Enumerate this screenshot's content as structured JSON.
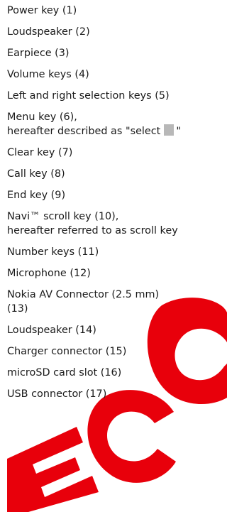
{
  "items": [
    {
      "label": "Power key (1)"
    },
    {
      "label": "Loudspeaker (2)"
    },
    {
      "label": "Earpiece (3)"
    },
    {
      "label": "Volume keys (4)"
    },
    {
      "label": "Left and right selection keys (5)"
    },
    {
      "label": "Menu key (6),",
      "line2_before": "hereafter described as \"select",
      "line2_after": "\""
    },
    {
      "label": "Clear key (7)"
    },
    {
      "label": "Call key (8)"
    },
    {
      "label": "End key (9)"
    },
    {
      "label": "Navi™ scroll key (10),",
      "line2": "hereafter referred to as scroll key"
    },
    {
      "label": "Number keys (11)"
    },
    {
      "label": "Microphone (12)"
    },
    {
      "label": "Nokia AV Connector (2.5 mm)",
      "line2": "(13)"
    },
    {
      "label": "Loudspeaker (14)"
    },
    {
      "label": "Charger connector (15)"
    },
    {
      "label": "microSD card slot (16)"
    },
    {
      "label": "USB connector (17)"
    }
  ],
  "watermark": {
    "text": "ECC",
    "color": "#e8000b"
  }
}
